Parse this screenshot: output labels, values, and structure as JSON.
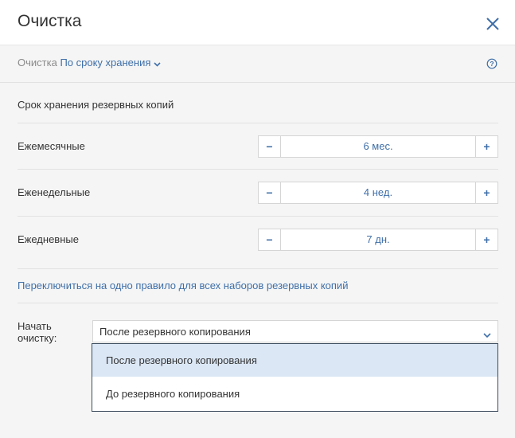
{
  "dialog": {
    "title": "Очистка",
    "close_icon": "close-icon"
  },
  "breadcrumb": {
    "prefix": "Очистка",
    "current": "По сроку хранения"
  },
  "retention": {
    "section_title": "Срок хранения резервных копий",
    "rows": [
      {
        "label": "Ежемесячные",
        "value": "6 мес."
      },
      {
        "label": "Еженедельные",
        "value": "4 нед."
      },
      {
        "label": "Ежедневные",
        "value": "7 дн."
      }
    ],
    "minus_symbol": "−",
    "plus_symbol": "+"
  },
  "switch_link": "Переключиться на одно правило для всех наборов резервных копий",
  "start_cleanup": {
    "label": "Начать очистку:",
    "selected": "После резервного копирования",
    "options": [
      "После резервного копирования",
      "До резервного копирования"
    ]
  },
  "colors": {
    "accent": "#3f6fa8",
    "selected_option_bg": "#dbe7f5",
    "body_bg": "#f5f5f5"
  }
}
